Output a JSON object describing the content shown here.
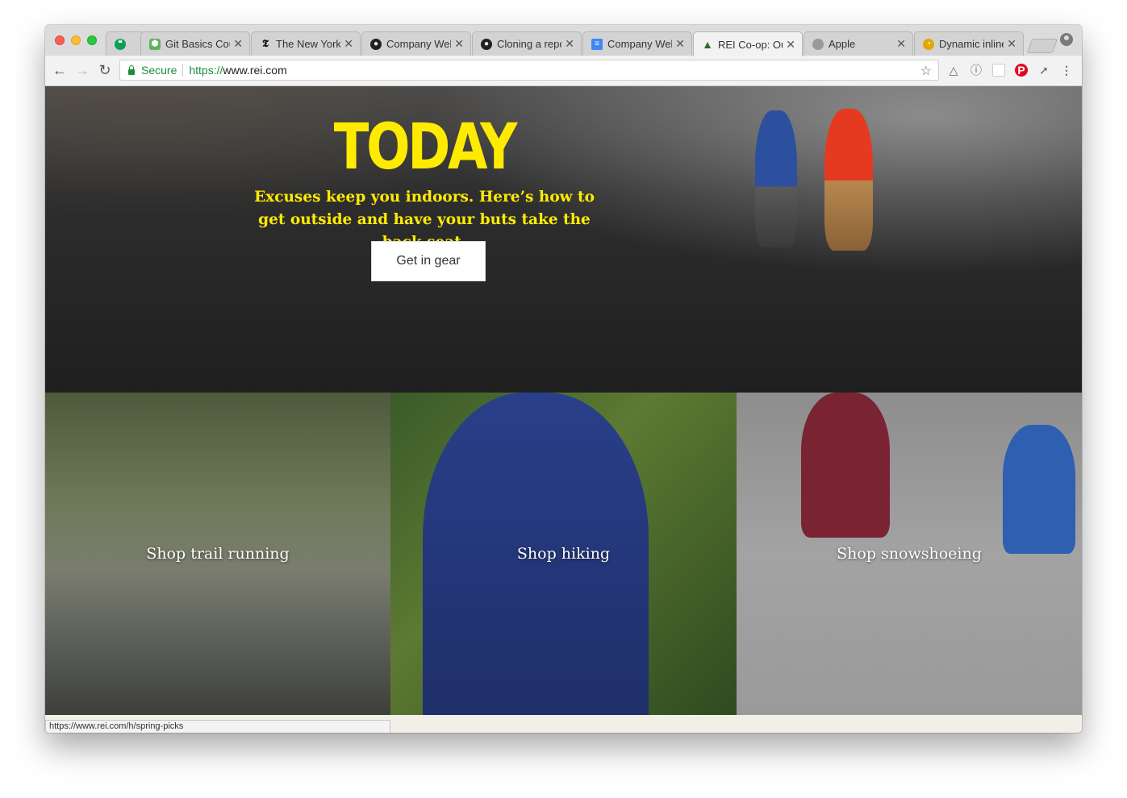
{
  "browser": {
    "tabs": [
      {
        "label": "",
        "favicon": "hangouts-icon",
        "color": "#0f9d58"
      },
      {
        "label": "Git Basics Cou",
        "favicon": "hexagon-icon",
        "color": "#5fb35f"
      },
      {
        "label": "The New York",
        "favicon": "nyt-icon",
        "color": "#111111"
      },
      {
        "label": "Company Web",
        "favicon": "github-icon",
        "color": "#222222"
      },
      {
        "label": "Cloning a repo",
        "favicon": "github-icon",
        "color": "#222222"
      },
      {
        "label": "Company Web",
        "favicon": "docs-icon",
        "color": "#4285f4"
      },
      {
        "label": "REI Co-op: Ou",
        "favicon": "tree-icon",
        "color": "#2f6b2f"
      },
      {
        "label": "Apple",
        "favicon": "apple-icon",
        "color": "#888888"
      },
      {
        "label": "Dynamic inline",
        "favicon": "gauge-icon",
        "color": "#e0a800"
      }
    ],
    "active_tab": 6,
    "address": {
      "secure_label": "Secure",
      "scheme": "https://",
      "host": "www.rei.com"
    },
    "status_url": "https://www.rei.com/h/spring-picks"
  },
  "hero": {
    "title": "TODAY",
    "subtitle": "Excuses keep you indoors. Here’s how to get outside and have your buts take the back seat.",
    "cta_label": "Get in gear",
    "accent_color": "#ffeb00"
  },
  "tiles": [
    {
      "label": "Shop trail running"
    },
    {
      "label": "Shop hiking"
    },
    {
      "label": "Shop snowshoeing"
    }
  ]
}
